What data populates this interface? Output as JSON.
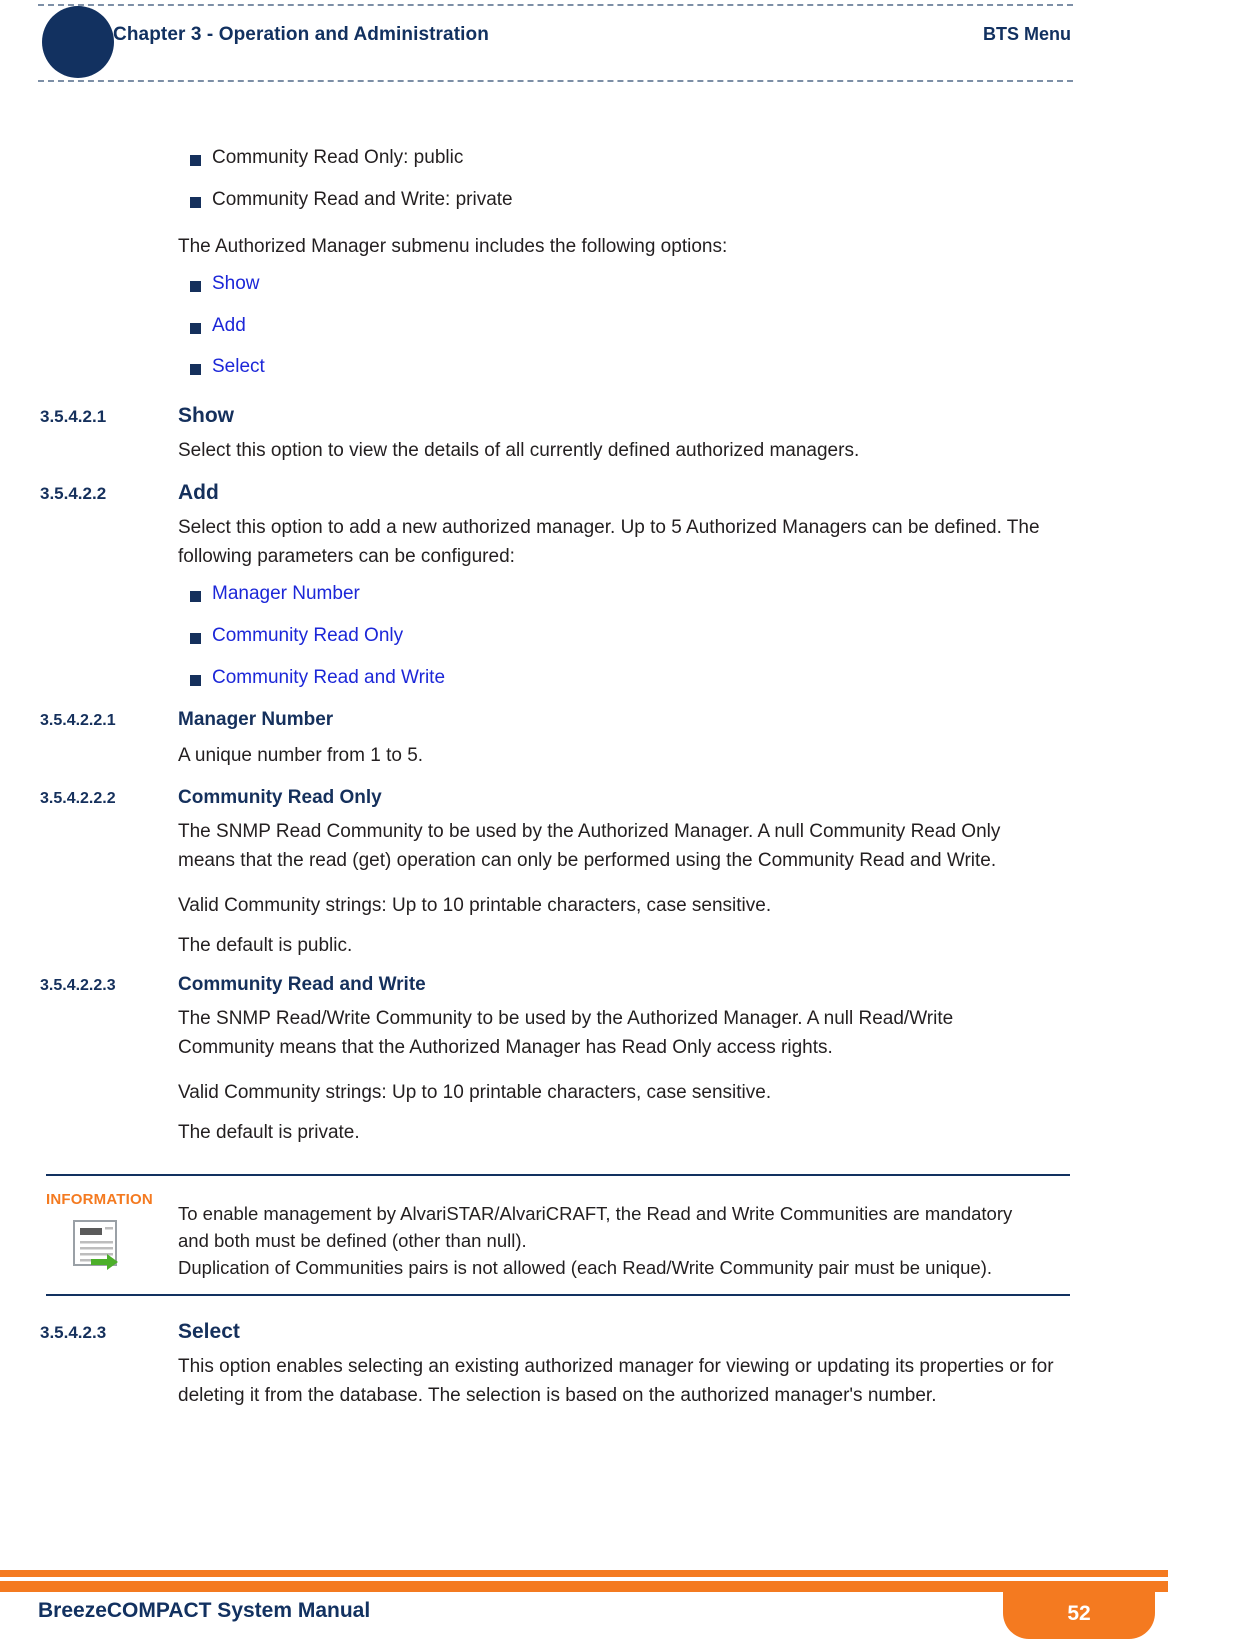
{
  "header": {
    "chapter": "Chapter 3 - Operation and Administration",
    "right_label": "BTS Menu",
    "circle_icon": "navy-circle-decoration"
  },
  "colors": {
    "navy": "#15305c",
    "link_blue": "#1c27d8",
    "orange": "#f47a20",
    "body_text": "#231f20"
  },
  "body": {
    "bullets_top": [
      {
        "text": "Community Read Only: public",
        "link": false
      },
      {
        "text": "Community Read and Write: private",
        "link": false
      }
    ],
    "intro_paragraph": "The Authorized Manager submenu includes the following options:",
    "bullets_options": [
      {
        "text": "Show",
        "link": true
      },
      {
        "text": "Add",
        "link": true
      },
      {
        "text": "Select",
        "link": true
      }
    ],
    "sections": [
      {
        "number": "3.5.4.2.1",
        "title": "Show",
        "paragraphs": [
          "Select this option to view the details of all currently defined authorized managers."
        ]
      },
      {
        "number": "3.5.4.2.2",
        "title": "Add",
        "paragraphs": [
          "Select this option to add a new authorized manager. Up to 5 Authorized Managers can be defined. The following parameters can be configured:"
        ],
        "bullets": [
          {
            "text": "Manager Number",
            "link": true
          },
          {
            "text": "Community Read Only",
            "link": true
          },
          {
            "text": "Community Read and Write",
            "link": true
          }
        ]
      },
      {
        "number": "3.5.4.2.2.1",
        "title": "Manager Number",
        "paragraphs": [
          "A unique number from 1 to 5."
        ]
      },
      {
        "number": "3.5.4.2.2.2",
        "title": "Community Read Only",
        "paragraphs": [
          "The SNMP Read Community to be used by the Authorized Manager. A null Community Read Only means that the read (get) operation can only be performed using the Community Read and Write.",
          "Valid Community strings: Up to 10 printable characters, case sensitive.",
          "The default is public."
        ]
      },
      {
        "number": "3.5.4.2.2.3",
        "title": "Community Read and Write",
        "paragraphs": [
          "The SNMP Read/Write Community to be used by the Authorized Manager. A null Read/Write Community means that the Authorized Manager has Read Only access rights.",
          "Valid Community strings: Up to 10 printable characters, case sensitive.",
          "The default is private."
        ]
      }
    ],
    "note": {
      "label": "INFORMATION",
      "icon": "document-export-icon",
      "lines": [
        "To enable management by AlvariSTAR/AlvariCRAFT, the Read and Write Communities are mandatory and both must be defined (other than null).",
        "Duplication of Communities pairs is not allowed (each Read/Write Community pair must be unique)."
      ]
    },
    "final_section": {
      "number": "3.5.4.2.3",
      "title": "Select",
      "paragraphs": [
        "This option enables selecting an existing authorized manager for viewing or updating its properties or for deleting it from the database. The selection is based on the authorized manager's number."
      ]
    }
  },
  "footer": {
    "title": "BreezeCOMPACT System Manual",
    "page_number": "52"
  }
}
